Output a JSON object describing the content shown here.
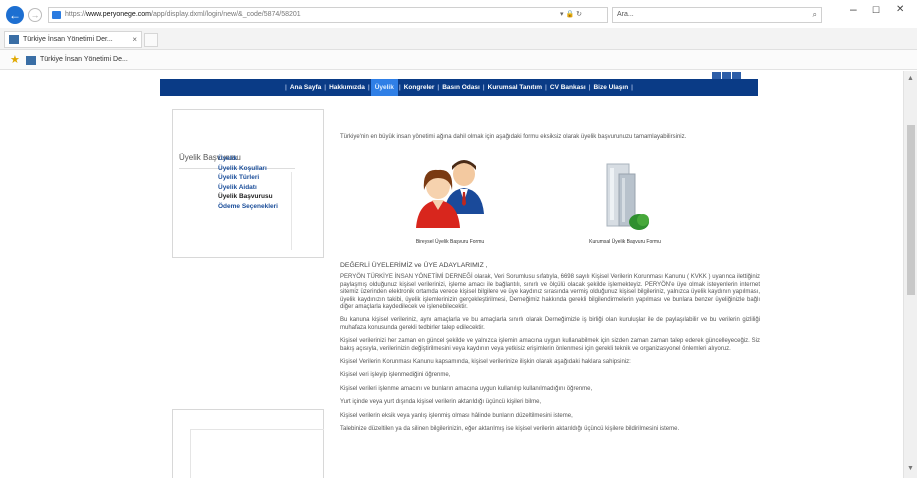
{
  "browser": {
    "address_secure_part": "https://",
    "address_host": "www.peryonege.com",
    "address_rest": "/app/display.dxml/login/new/&_code/5874/58201",
    "address_controls": "▾ 🔒 ↻",
    "search_value": "Ara...",
    "search_glyph": "⌕",
    "window_controls": {
      "minimize": "–",
      "maximize": "☐",
      "close": "✕"
    },
    "tab_title": "Türkiye İnsan Yönetimi Der...",
    "tab_close": "× ",
    "favorite_title": "Türkiye İnsan Yönetimi De..."
  },
  "nav": {
    "items": [
      "Ana Sayfa",
      "Hakkımızda",
      "Üyelik",
      "Kongreler",
      "Basın Odası",
      "Kurumsal Tanıtım",
      "CV Bankası",
      "Bize Ulaşın"
    ],
    "active_index": 2
  },
  "sidebar": {
    "title": "Üyelik Başvurusu",
    "items": [
      "Üyelik",
      "Üyelik Koşulları",
      "Üyelik Türleri",
      "Üyelik Aidatı",
      "Üyelik Başvurusu",
      "Ödeme Seçenekleri"
    ],
    "current_index": 4
  },
  "main": {
    "intro": "Türkiye'nin en büyük insan yönetimi ağına dahil olmak için aşağıdaki formu eksiksiz olarak üyelik başvurunuzu tamamlayabilirsiniz.",
    "form_individual": "Bireysel Üyelik Başvuru Formu",
    "form_corporate": "Kurumsal Üyelik Başvuru Formu",
    "heading": "DEĞERLİ ÜYELERİMİZ ve ÜYE ADAYLARIMIZ ,",
    "paragraphs": [
      "PERYÖN TÜRKİYE İNSAN YÖNETİMİ DERNEĞİ olarak, Veri Sorumlusu sıfatıyla, 6698 sayılı Kişisel Verilerin Korunması Kanunu ( KVKK ) uyarınca ilettiğiniz paylaşmış olduğunuz kişisel verilerinizi, işleme amacı ile bağlantılı, sınırlı ve ölçülü olacak şekilde işlemekteyiz. PERYÖN'e üye olmak isteyenlerin internet sitemiz üzerinden elektronik ortamda verece kişisel bilgilere ve üye kaydınız sırasında vermiş olduğunuz kişisel bilgileriniz, yalnızca üyelik kaydının yapılması, üyelik kaydınızın takibi, üyelik işlemlerinizin gerçekleştirilmesi, Derneğimiz hakkında gerekli bilgilendirmelerin yapılması ve bunlara benzer üyeliğinizle bağlı diğer amaçlarla kaydedilecek ve işlenebilecektir.",
      "Bu kanuna kişisel verileriniz, aynı amaçlarla ve bu amaçlarla sınırlı olarak Derneğimizle iş birliği olan kuruluşlar ile de paylaşılabilir ve bu verilerin gizliliği muhafaza konusunda gerekli tedbirler talep edilecektir.",
      "Kişisel verilerinizi her zaman en güncel şekilde ve yalnızca işlemin amacına uygun kullanabilmek için sizden zaman zaman talep ederek güncelleyeceğiz. Siz bakış açısıyla, verilerinizin değiştirilmesini veya kaydının veya yetkisiz erişimlerin önlenmesi için gerekli teknik ve organizasyonel önlemleri alıyoruz.",
      "Kişisel Verilerin Korunması Kanunu kapsamında, kişisel verilerinize ilişkin olarak aşağıdaki haklara sahipsiniz:",
      "Kişisel veri işleyip işlenmediğini öğrenme,",
      "Kişisel verileri işlenme amacını ve bunların amacına uygun kullanılıp kullanılmadığını öğrenme,",
      "Yurt içinde veya yurt dışında kişisel verilerin aktarıldığı üçüncü kişileri bilme,",
      "Kişisel verilerin eksik veya yanlış işlenmiş olması hâlinde bunların düzeltilmesini isteme,",
      "Talebinize düzeltilen ya da silinen bilgilerinizin, eğer aktarılmış ise kişisel verilerin aktarıldığı üçüncü kişilere bildirilmesini isteme."
    ]
  },
  "colors": {
    "nav_bg": "#0a3b86",
    "nav_active": "#2f7fe6",
    "link": "#1a4d99"
  }
}
